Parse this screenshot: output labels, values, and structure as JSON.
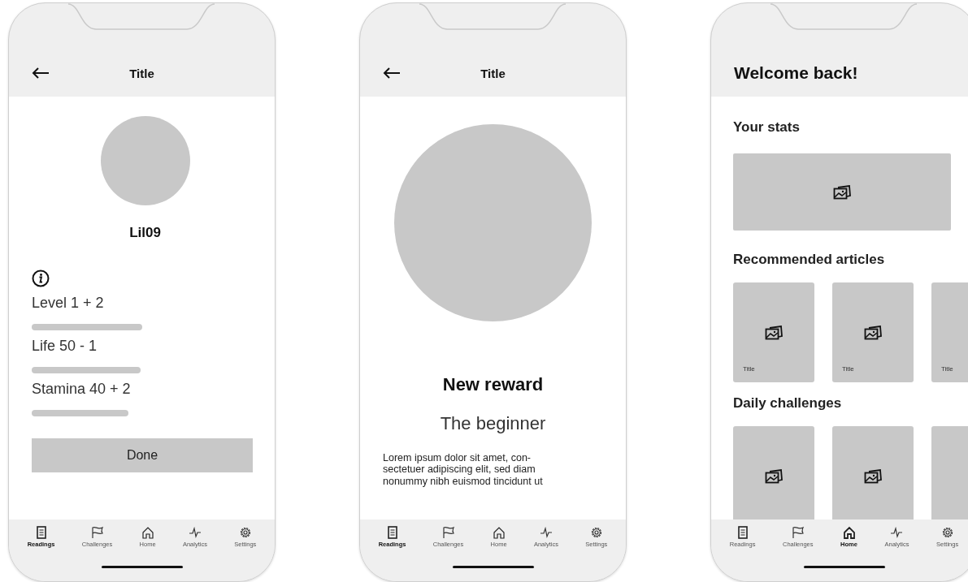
{
  "phones": [
    {
      "kind": "profile",
      "title": "Title",
      "name": "Lil09",
      "stats": [
        {
          "label": "Level 1 + 2"
        },
        {
          "label": "Life 50 - 1"
        },
        {
          "label": "Stamina 40 + 2"
        }
      ],
      "button": "Done",
      "nav": [
        {
          "label": "Readings",
          "selected": true
        },
        {
          "label": "Challenges",
          "selected": false
        },
        {
          "label": "Home",
          "selected": false
        },
        {
          "label": "Analytics",
          "selected": false
        },
        {
          "label": "Settings",
          "selected": false
        }
      ]
    },
    {
      "kind": "reward",
      "title": "Title",
      "heading": "New reward",
      "subheading": "The beginner",
      "body_lines": [
        "Lorem ipsum dolor sit amet, con-",
        "sectetuer adipiscing elit, sed diam",
        "nonummy nibh euismod tincidunt ut"
      ],
      "nav": [
        {
          "label": "Readings",
          "selected": true
        },
        {
          "label": "Challenges",
          "selected": false
        },
        {
          "label": "Home",
          "selected": false
        },
        {
          "label": "Analytics",
          "selected": false
        },
        {
          "label": "Settings",
          "selected": false
        }
      ]
    },
    {
      "kind": "home",
      "title": "Welcome back!",
      "sections": [
        {
          "kind": "banner",
          "heading": "Your stats"
        },
        {
          "kind": "cards",
          "heading": "Recommended articles",
          "cards": [
            {
              "title": "Title",
              "icon": true
            },
            {
              "title": "Title",
              "icon": true
            },
            {
              "title": "Title",
              "icon": false
            }
          ]
        },
        {
          "kind": "cards",
          "heading": "Daily challenges",
          "cards": [
            {
              "icon": true
            },
            {
              "icon": true
            },
            {
              "icon": false
            }
          ]
        }
      ],
      "nav": [
        {
          "label": "Readings",
          "selected": false
        },
        {
          "label": "Challenges",
          "selected": false
        },
        {
          "label": "Home",
          "selected": true
        },
        {
          "label": "Analytics",
          "selected": false
        },
        {
          "label": "Settings",
          "selected": false
        }
      ]
    }
  ]
}
